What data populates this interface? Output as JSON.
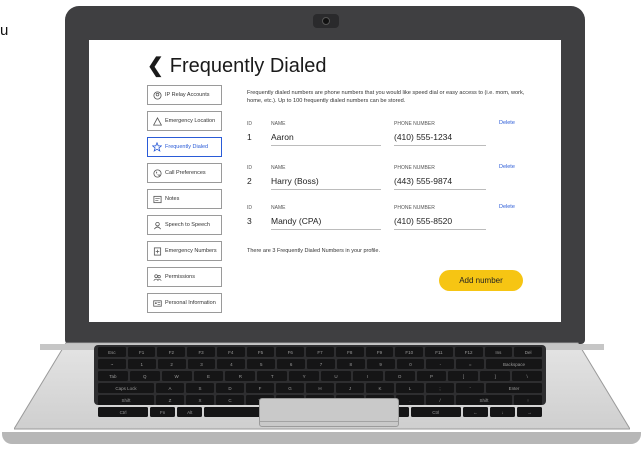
{
  "stray_text": "u",
  "app": {
    "back_icon": "chevron-left-icon",
    "title": "Frequently Dialed",
    "sidebar": [
      {
        "label": "IP Relay Accounts",
        "icon": "id-icon"
      },
      {
        "label": "Emergency Location",
        "icon": "warning-icon"
      },
      {
        "label": "Frequently Dialed",
        "icon": "star-icon",
        "active": true
      },
      {
        "label": "Call Preferences",
        "icon": "phone-icon"
      },
      {
        "label": "Notes",
        "icon": "notes-icon"
      },
      {
        "label": "Speech to Speech",
        "icon": "speech-icon"
      },
      {
        "label": "Emergency Numbers",
        "icon": "emergency-numbers-icon"
      },
      {
        "label": "Permissions",
        "icon": "permissions-icon"
      },
      {
        "label": "Personal Information",
        "icon": "personal-info-icon"
      }
    ],
    "intro": "Frequently dialed numbers are phone numbers that you would like speed dial or easy access to (i.e. mom, work, home, etc.). Up to 100 frequently dialed numbers can be stored.",
    "labels": {
      "id": "ID",
      "name": "NAME",
      "phone": "PHONE NUMBER",
      "delete": "Delete"
    },
    "entries": [
      {
        "id": "1",
        "name": "Aaron",
        "phone": "(410) 555-1234"
      },
      {
        "id": "2",
        "name": "Harry (Boss)",
        "phone": "(443) 555-9874"
      },
      {
        "id": "3",
        "name": "Mandy (CPA)",
        "phone": "(410) 555-8520"
      }
    ],
    "summary": "There are 3 Frequently Dialed Numbers in your profile.",
    "add_button": "Add number",
    "accent_color": "#f6c513",
    "link_color": "#2a5bd7"
  },
  "keyboard": {
    "rows": [
      [
        "Esc",
        "F1",
        "F2",
        "F3",
        "F4",
        "F5",
        "F6",
        "F7",
        "F8",
        "F9",
        "F10",
        "F11",
        "F12",
        "Ins",
        "Del"
      ],
      [
        "~",
        "1",
        "2",
        "3",
        "4",
        "5",
        "6",
        "7",
        "8",
        "9",
        "0",
        "-",
        "=",
        "Backspace"
      ],
      [
        "Tab",
        "Q",
        "W",
        "E",
        "R",
        "T",
        "Y",
        "U",
        "I",
        "O",
        "P",
        "[",
        "]",
        "\\"
      ],
      [
        "Caps Lock",
        "A",
        "S",
        "D",
        "F",
        "G",
        "H",
        "J",
        "K",
        "L",
        ";",
        "'",
        "Enter"
      ],
      [
        "Shift",
        "Z",
        "X",
        "C",
        "V",
        "B",
        "N",
        "M",
        ",",
        ".",
        "/",
        "Shift",
        "↑"
      ],
      [
        "Ctrl",
        "Fn",
        "Alt",
        "",
        "Alt",
        "▤",
        "Ctrl",
        "←",
        "↓",
        "→"
      ]
    ]
  }
}
